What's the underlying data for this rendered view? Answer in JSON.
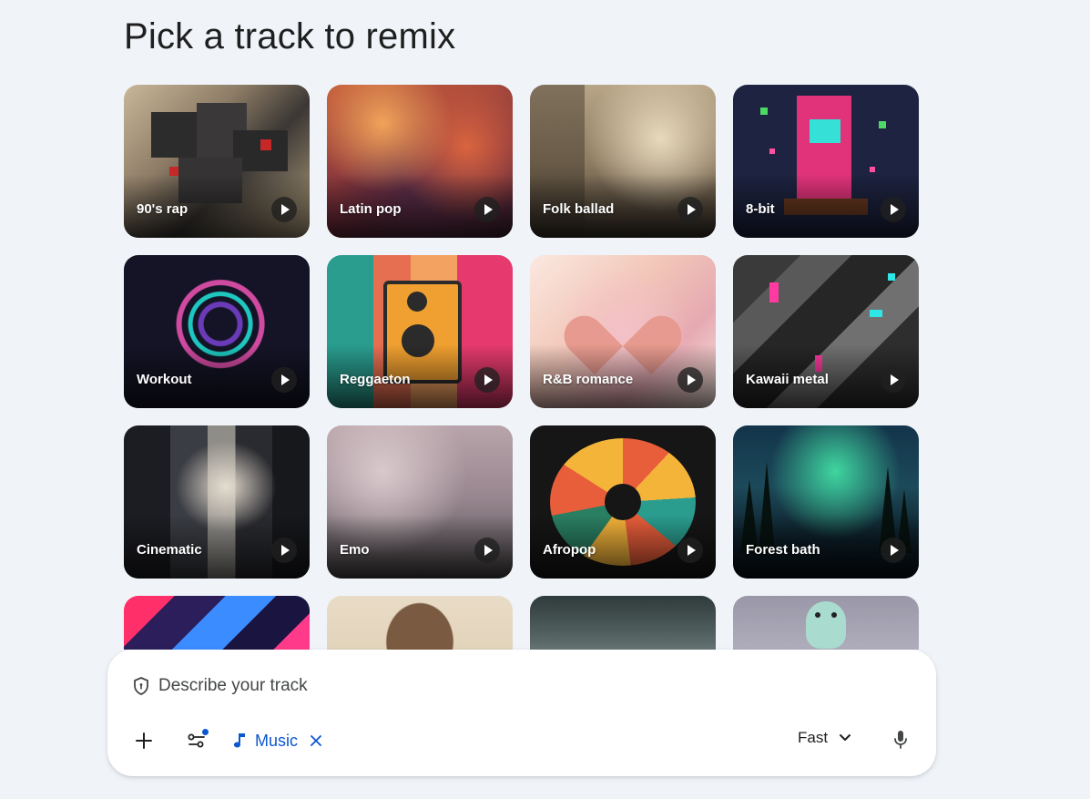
{
  "header": {
    "title": "Pick a track to remix"
  },
  "tracks": [
    {
      "label": "90's rap"
    },
    {
      "label": "Latin pop"
    },
    {
      "label": "Folk ballad"
    },
    {
      "label": "8-bit"
    },
    {
      "label": "Workout"
    },
    {
      "label": "Reggaeton"
    },
    {
      "label": "R&B romance"
    },
    {
      "label": "Kawaii metal"
    },
    {
      "label": "Cinematic"
    },
    {
      "label": "Emo"
    },
    {
      "label": "Afropop"
    },
    {
      "label": "Forest bath"
    },
    {
      "label": ""
    },
    {
      "label": ""
    },
    {
      "label": ""
    },
    {
      "label": ""
    }
  ],
  "prompt": {
    "placeholder": "Describe your track",
    "icon": "shield-icon",
    "add_icon": "plus-icon",
    "tools_icon": "tune-icon",
    "chip": {
      "label": "Music",
      "icon": "music-note-icon",
      "close_icon": "close-icon"
    },
    "mode": {
      "label": "Fast",
      "icon": "chevron-down-icon"
    },
    "mic_icon": "mic-icon"
  },
  "colors": {
    "background": "#f0f4f9",
    "accent": "#0b57d0",
    "card_text": "#ffffff"
  }
}
